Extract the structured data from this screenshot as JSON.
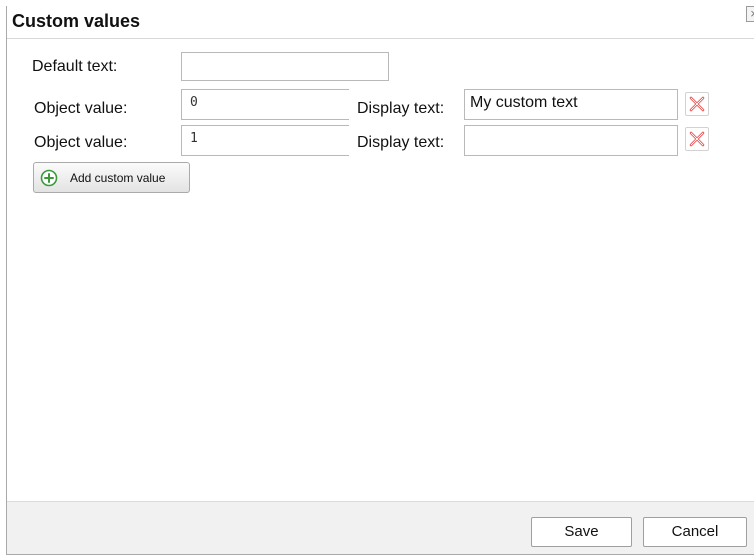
{
  "dialog": {
    "title": "Custom values",
    "close_glyph": "×"
  },
  "form": {
    "default_text_label": "Default text:",
    "default_text_value": "",
    "rows": [
      {
        "object_label": "Object value:",
        "object_value": "0",
        "display_label": "Display text:",
        "display_value": "My custom text",
        "delete_icon": "red-x-icon"
      },
      {
        "object_label": "Object value:",
        "object_value": "1",
        "display_label": "Display text:",
        "display_value": "",
        "delete_icon": "red-x-icon"
      }
    ],
    "add_button_label": "Add custom value",
    "add_icon": "green-plus-circle-icon"
  },
  "footer": {
    "save_label": "Save",
    "cancel_label": "Cancel"
  },
  "colors": {
    "delete_red": "#e23b3b",
    "add_green": "#3a9a3a"
  }
}
